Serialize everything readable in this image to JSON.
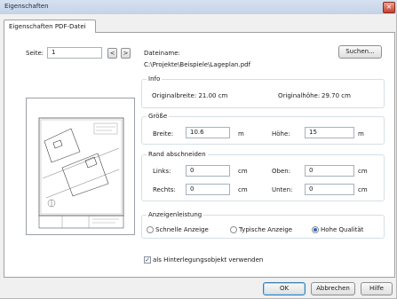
{
  "window": {
    "title": "Eigenschaften",
    "close_glyph": "×"
  },
  "tab": {
    "label": "Eigenschaften PDF-Datei"
  },
  "page_nav": {
    "label": "Seite:",
    "value": "1",
    "prev_glyph": "<",
    "next_glyph": ">"
  },
  "file": {
    "label": "Dateiname:",
    "path": "C:\\Projekte\\Beispiele\\Lageplan.pdf",
    "browse_label": "Suchen..."
  },
  "info": {
    "group_title": "Info",
    "width_label": "Originalbreite: 21.00 cm",
    "height_label": "Originalhöhe:",
    "height_value": "29.70 cm"
  },
  "size": {
    "group_title": "Größe",
    "width_label": "Breite:",
    "width_value": "10.6",
    "width_unit": "m",
    "height_label": "Höhe:",
    "height_value": "15",
    "height_unit": "m"
  },
  "crop": {
    "group_title": "Rand abschneiden",
    "left_label": "Links:",
    "left_value": "0",
    "left_unit": "cm",
    "top_label": "Oben:",
    "top_value": "0",
    "top_unit": "cm",
    "right_label": "Rechts:",
    "right_value": "0",
    "right_unit": "cm",
    "bottom_label": "Unten:",
    "bottom_value": "0",
    "bottom_unit": "cm"
  },
  "display": {
    "group_title": "Anzeigenleistung",
    "options": [
      "Schnelle Anzeige",
      "Typische Anzeige",
      "Hohe Qualität"
    ],
    "selected": "Hohe Qualität"
  },
  "background": {
    "label": "als Hinterlegungsobjekt verwenden",
    "checked": true,
    "check_glyph": "✓"
  },
  "buttons": {
    "ok": "OK",
    "cancel": "Abbrechen",
    "help": "Hilfe"
  }
}
